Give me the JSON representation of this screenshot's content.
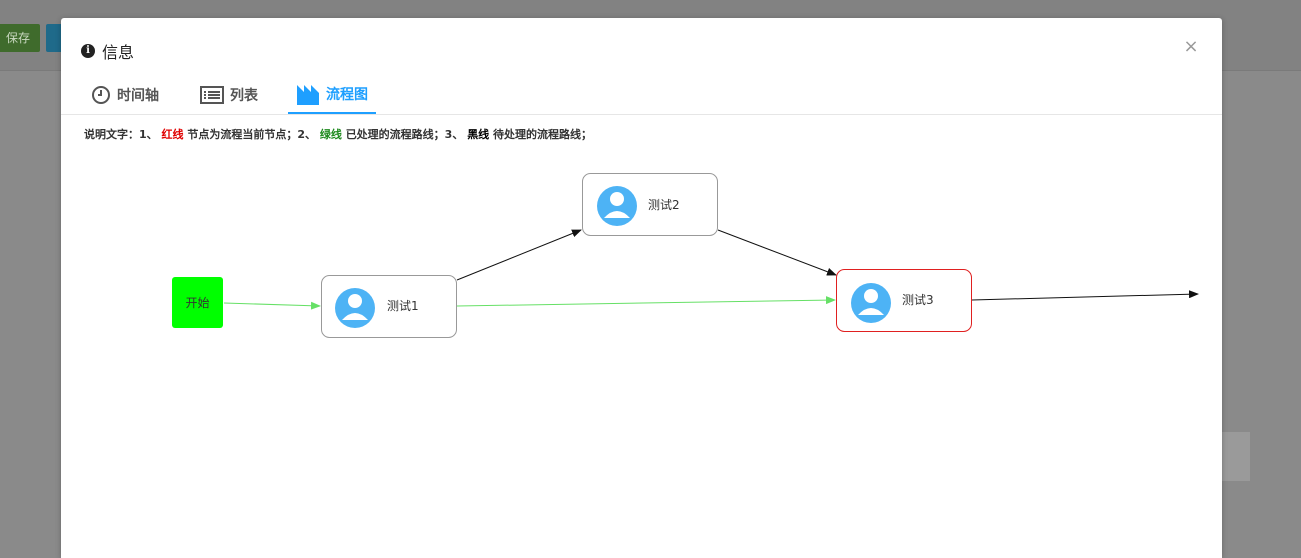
{
  "background": {
    "save_label": "保存"
  },
  "modal": {
    "title": "信息",
    "close_label": "×"
  },
  "tabs": [
    {
      "label": "时间轴",
      "icon": "clock-icon"
    },
    {
      "label": "列表",
      "icon": "list-icon"
    },
    {
      "label": "流程图",
      "icon": "chart-icon",
      "active": true
    }
  ],
  "legend_note": {
    "prefix": "说明文字：1、",
    "red_word": "红线",
    "part1": "节点为流程当前节点；2、",
    "green_word": "绿线",
    "part2": "已处理的流程路线；3、",
    "black_word": "黑线",
    "part3": "待处理的流程路线；"
  },
  "flow": {
    "start_label": "开始",
    "nodes": [
      {
        "id": "n1",
        "label": "测试1",
        "current": false
      },
      {
        "id": "n2",
        "label": "测试2",
        "current": false
      },
      {
        "id": "n3",
        "label": "测试3",
        "current": true
      }
    ],
    "colors": {
      "start_fill": "#00ff00",
      "processed_line": "#66e066",
      "pending_line": "#222222",
      "current_border": "#e02020",
      "node_border": "#999999",
      "avatar": "#4db3f5"
    }
  }
}
